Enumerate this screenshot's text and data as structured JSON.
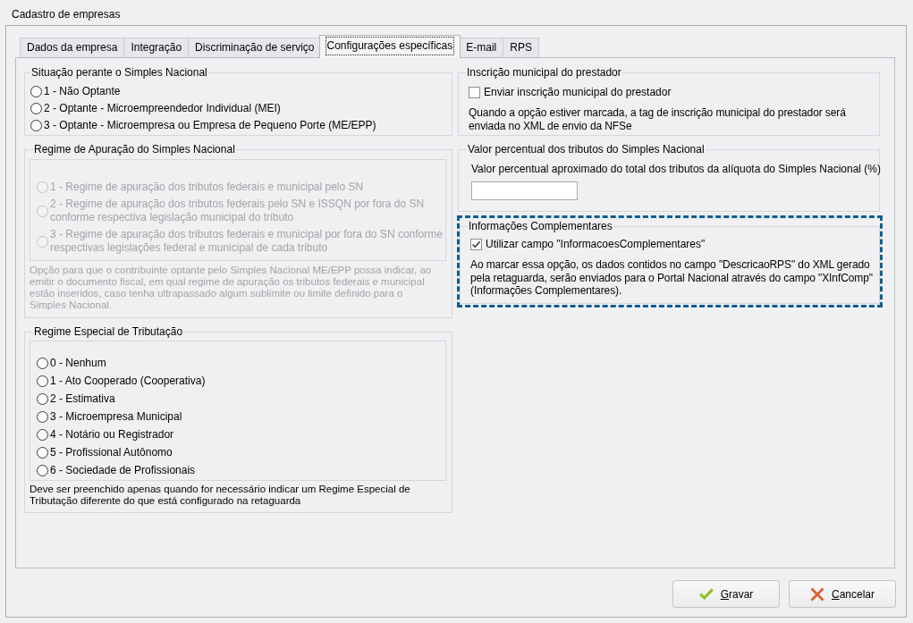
{
  "window": {
    "title": "Cadastro de empresas"
  },
  "tabs": [
    {
      "label": "Dados da empresa",
      "selected": false
    },
    {
      "label": "Integração",
      "selected": false
    },
    {
      "label": "Discriminação de serviço",
      "selected": false
    },
    {
      "label": "Configurações específicas",
      "selected": true
    },
    {
      "label": "E-mail",
      "selected": false
    },
    {
      "label": "RPS",
      "selected": false
    }
  ],
  "left_column": [
    {
      "kind": "radio_list",
      "title": "Situação perante o Simples Nacional",
      "disabled": false,
      "highlighted": false,
      "options": [
        {
          "label": "1 - Não Optante",
          "selected": false
        },
        {
          "label": "2 - Optante - Microempreendedor Individual (MEI)",
          "selected": false
        },
        {
          "label": "3 - Optante - Microempresa ou Empresa de Pequeno Porte (ME/EPP)",
          "selected": false
        }
      ]
    },
    {
      "kind": "radio_box",
      "title": "Regime de Apuração do Simples Nacional",
      "disabled": true,
      "highlighted": false,
      "options": [
        {
          "label": "1 - Regime de apuração dos tributos federais e municipal pelo SN",
          "selected": false
        },
        {
          "label": "2 - Regime de apuração dos tributos federais pelo SN e ISSQN por fora do SN conforme respectiva legislação municipal do tributo",
          "selected": false
        },
        {
          "label": "3 - Regime de apuração dos tributos federais e municipal por fora do SN conforme respectivas legislações federal e municipal de cada tributo",
          "selected": false
        }
      ],
      "note": "Opção para que o contribuinte optante pelo Simples Nacional ME/EPP possa indicar, ao emitir o documento fiscal, em qual regime de apuração os tributos federais e municipal estão inseridos, caso tenha ultrapassado algum sublimite ou limite definido para o Simples Nacional."
    },
    {
      "kind": "radio_box",
      "title": "Regime Especial de Tributação",
      "disabled": false,
      "highlighted": false,
      "options": [
        {
          "label": "0 - Nenhum",
          "selected": false
        },
        {
          "label": "1 - Ato Cooperado (Cooperativa)",
          "selected": false
        },
        {
          "label": "2 - Estimativa",
          "selected": false
        },
        {
          "label": "3 - Microempresa Municipal",
          "selected": false
        },
        {
          "label": "4 - Notário ou Registrador",
          "selected": false
        },
        {
          "label": "5 - Profissional Autônomo",
          "selected": false
        },
        {
          "label": "6 - Sociedade de Profissionais",
          "selected": false
        }
      ],
      "note": "Deve ser preenchido apenas quando for necessário indicar um Regime Especial de Tributação diferente do que está configurado na retaguarda"
    }
  ],
  "right_column": [
    {
      "kind": "checkbox",
      "title": "Inscrição municipal do prestador",
      "highlighted": false,
      "checkbox": {
        "label": "Enviar inscrição municipal do prestador",
        "checked": false
      },
      "note": "Quando a opção estiver marcada, a tag de inscrição municipal do prestador será enviada no XML de envio da NFSe"
    },
    {
      "kind": "input",
      "title": "Valor percentual dos tributos do Simples Nacional",
      "highlighted": false,
      "field_label": "Valor percentual aproximado do total dos tributos da alíquota do Simples Nacional (%)"
    },
    {
      "kind": "checkbox",
      "title": "Informações Complementares",
      "highlighted": true,
      "checkbox": {
        "label": "Utilizar campo \"InformacoesComplementares\"",
        "checked": true
      },
      "note": "Ao marcar essa opção, os dados contidos no campo \"DescricaoRPS\" do XML gerado pela retaguarda, serão enviados para o Portal Nacional através do campo \"XInfComp\" (Informações Complementares)."
    }
  ],
  "buttons": [
    {
      "kind": "save",
      "label": "Gravar"
    },
    {
      "kind": "cancel",
      "label": "Cancelar"
    }
  ]
}
